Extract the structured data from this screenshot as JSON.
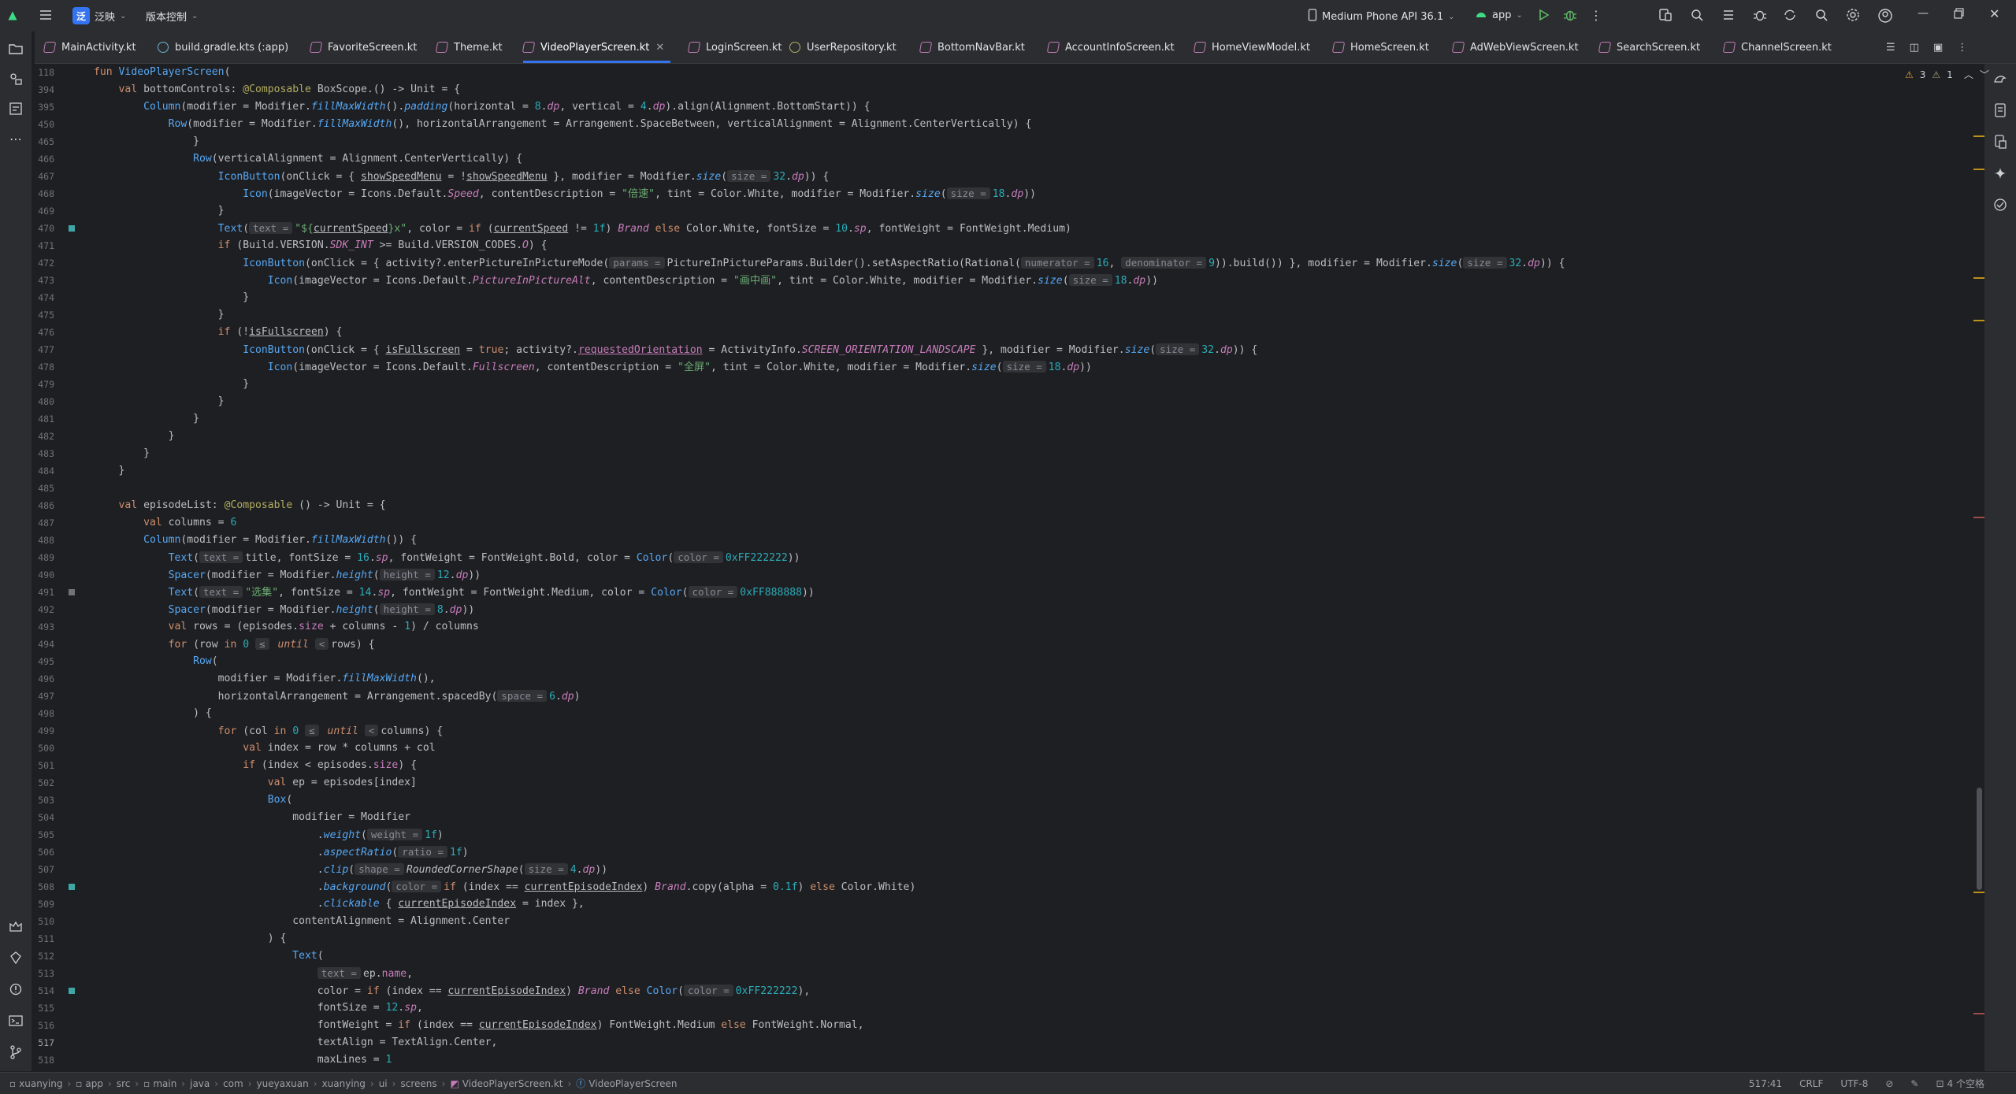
{
  "toolbar": {
    "project_badge": "泛",
    "project_name": "泛映",
    "vcs_label": "版本控制",
    "device": "Medium Phone API 36.1",
    "run_config": "app"
  },
  "tabs": [
    {
      "label": "MainActivity.kt",
      "type": "kotlin",
      "active": false
    },
    {
      "label": "build.gradle.kts (:app)",
      "type": "gradle",
      "active": false
    },
    {
      "label": "FavoriteScreen.kt",
      "type": "kotlin",
      "active": false
    },
    {
      "label": "Theme.kt",
      "type": "kotlin",
      "active": false
    },
    {
      "label": "VideoPlayerScreen.kt",
      "type": "kotlin",
      "active": true
    },
    {
      "label": "LoginScreen.kt",
      "type": "kotlin",
      "active": false
    },
    {
      "label": "UserRepository.kt",
      "type": "kotlin",
      "active": false
    },
    {
      "label": "BottomNavBar.kt",
      "type": "kotlin",
      "active": false
    },
    {
      "label": "AccountInfoScreen.kt",
      "type": "kotlin",
      "active": false
    },
    {
      "label": "HomeViewModel.kt",
      "type": "kotlin",
      "active": false
    },
    {
      "label": "HomeScreen.kt",
      "type": "kotlin",
      "active": false
    },
    {
      "label": "AdWebViewScreen.kt",
      "type": "kotlin",
      "active": false
    },
    {
      "label": "SearchScreen.kt",
      "type": "kotlin",
      "active": false
    },
    {
      "label": "ChannelScreen.kt",
      "type": "kotlin",
      "active": false
    }
  ],
  "inspections": {
    "warnings": "3",
    "weak_warnings": "1"
  },
  "line_numbers": [
    "118",
    "394",
    "395",
    "450",
    "465",
    "466",
    "467",
    "468",
    "469",
    "470",
    "471",
    "472",
    "473",
    "474",
    "475",
    "476",
    "477",
    "478",
    "479",
    "480",
    "481",
    "482",
    "483",
    "484",
    "485",
    "486",
    "487",
    "488",
    "489",
    "490",
    "491",
    "492",
    "493",
    "494",
    "495",
    "496",
    "497",
    "498",
    "499",
    "500",
    "501",
    "502",
    "503",
    "504",
    "505",
    "506",
    "507",
    "508",
    "509",
    "510",
    "511",
    "512",
    "513",
    "514",
    "515",
    "516",
    "517",
    "518"
  ],
  "current_line": "517",
  "status": {
    "breadcrumbs": [
      "xuanying",
      "app",
      "src",
      "main",
      "java",
      "com",
      "yueyaxuan",
      "xuanying",
      "ui",
      "screens",
      "VideoPlayerScreen.kt",
      "VideoPlayerScreen"
    ],
    "position": "517:41",
    "line_sep": "CRLF",
    "encoding": "UTF-8",
    "indent": "4 个空格"
  },
  "icons": [
    "hamburger-menu-icon",
    "folder-icon",
    "run-icon",
    "debug-icon",
    "search-icon",
    "settings-icon",
    "account-icon",
    "bell-icon",
    "gemini-icon"
  ]
}
